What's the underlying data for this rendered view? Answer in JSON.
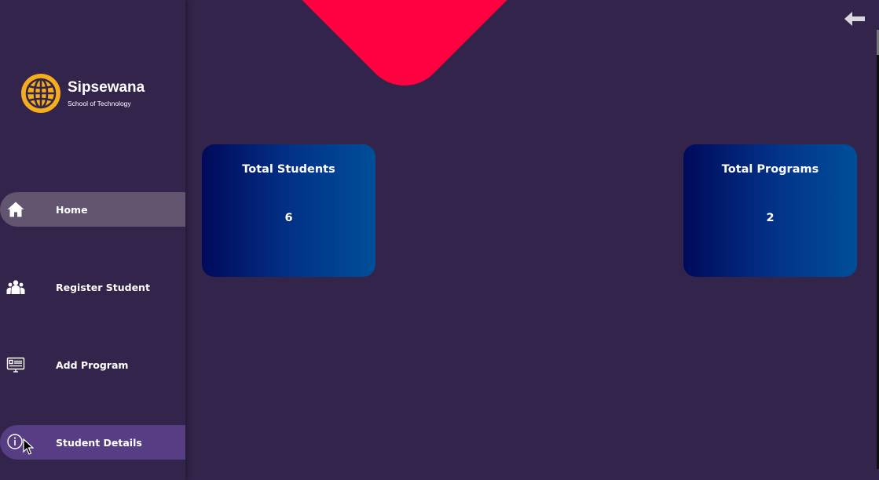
{
  "brand": {
    "name": "Sipsewana",
    "subtitle": "School of Technology",
    "logo_icon": "globe-icon",
    "logo_color": "#f6ad1c"
  },
  "nav": {
    "items": [
      {
        "label": "Home",
        "icon": "home-icon",
        "state": "active"
      },
      {
        "label": "Register Student",
        "icon": "users-group-icon",
        "state": "normal"
      },
      {
        "label": "Add Program",
        "icon": "monitor-list-icon",
        "state": "normal"
      },
      {
        "label": "Student Details",
        "icon": "info-circle-icon",
        "state": "hover"
      }
    ]
  },
  "cards": [
    {
      "title": "Total Students",
      "value": "6"
    },
    {
      "title": "Total Programs",
      "value": "2"
    }
  ],
  "toolbar": {
    "back_icon": "arrow-left-icon"
  },
  "colors": {
    "background": "#32244a",
    "accent_shape": "#ff0040",
    "active_nav": "#635470",
    "hover_nav": "#573d83",
    "card_gradient_start": "#010a5a",
    "card_gradient_end": "#004e98"
  }
}
